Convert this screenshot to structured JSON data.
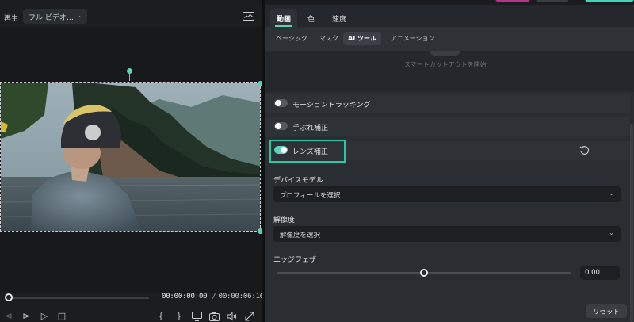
{
  "preview": {
    "playback_label": "再生",
    "quality_value": "フル ビデオ…",
    "timecode_current": "00:00:00:00",
    "timecode_separator": "/",
    "timecode_duration": "00:00:06:16",
    "playhead_fraction": 0.0
  },
  "tabs": {
    "main": [
      "動画",
      "色",
      "速度"
    ],
    "main_active": "動画",
    "sub": [
      "ベーシック",
      "マスク",
      "AI ツール",
      "アニメーション"
    ],
    "sub_active": "AI ツール"
  },
  "ai_tools": {
    "smart_cutout_label": "スマートカットアウトを開始",
    "features": [
      {
        "label": "モーショントラッキング",
        "enabled": false
      },
      {
        "label": "手ぶれ補正",
        "enabled": false
      },
      {
        "label": "レンズ補正",
        "enabled": true
      }
    ],
    "device_model_label": "デバイスモデル",
    "device_model_value": "プロフィールを選択",
    "resolution_label": "解像度",
    "resolution_value": "解像度を選択",
    "edge_feather_label": "エッジフェザー",
    "edge_feather_value": "0.00",
    "edge_feather_fraction": 0.5,
    "reset_label": "リセット"
  },
  "colors": {
    "accent": "#5fd1b6",
    "highlight_border": "#2bc6a4",
    "top_button_pink": "#b4348c",
    "top_button_teal": "#3fd9b8"
  },
  "icons": [
    "monitor-icon",
    "chevron-down-icon",
    "reset-icon",
    "prev-frame-icon",
    "play-pause-icon",
    "play-icon",
    "stop-icon",
    "mark-in-icon",
    "mark-out-icon",
    "display-icon",
    "snapshot-icon",
    "volume-icon",
    "fullscreen-icon"
  ]
}
